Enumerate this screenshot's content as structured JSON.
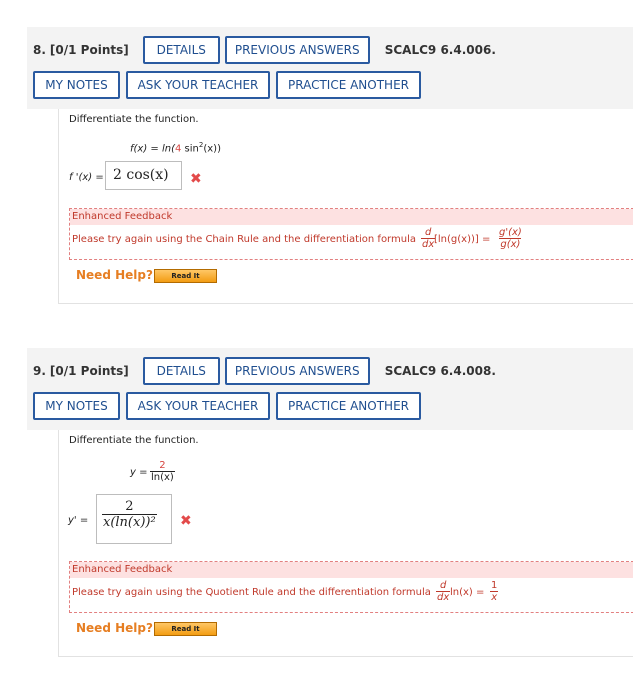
{
  "common": {
    "details": "DETAILS",
    "previous_answers": "PREVIOUS ANSWERS",
    "my_notes": "MY NOTES",
    "ask_teacher": "ASK YOUR TEACHER",
    "practice_another": "PRACTICE ANOTHER",
    "instruction": "Differentiate the function.",
    "enhanced_feedback": "Enhanced Feedback",
    "need_help": "Need Help?",
    "read_it": "Read It",
    "wrong_mark": "✖"
  },
  "q8": {
    "number": "8.",
    "points": "[0/1 Points]",
    "code": "SCALC9 6.4.006.",
    "function_lhs": "f(x) = ln(",
    "function_coef": "4",
    "function_rest": " sin",
    "function_exp": "2",
    "function_end": "(x))",
    "answer_label": "f '(x) = ",
    "answer_value": "2 cos(x)",
    "feedback_text": "Please try again using the Chain Rule and the differentiation formula",
    "formula_d": "d",
    "formula_dx": "dx",
    "formula_mid": "[ln(g(x))] =",
    "formula_num": "g'(x)",
    "formula_den": "g(x)"
  },
  "q9": {
    "number": "9.",
    "points": "[0/1 Points]",
    "code": "SCALC9 6.4.008.",
    "y_label": "y =",
    "y_num": "2",
    "y_den": "ln(x)",
    "answer_label": "y' =",
    "answer_num": "2",
    "answer_den": "x(ln(x))²",
    "feedback_text": "Please try again using the Quotient Rule and the differentiation formula",
    "formula_d": "d",
    "formula_dx": "dx",
    "formula_mid": "ln(x) =",
    "formula_num": "1",
    "formula_den": "x"
  }
}
